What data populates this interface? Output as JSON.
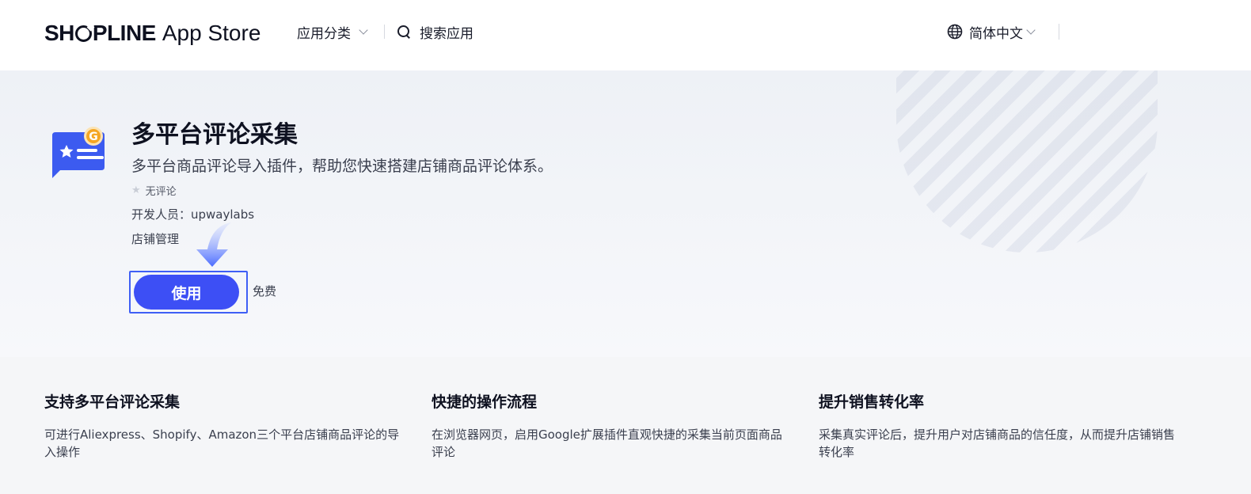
{
  "header": {
    "brand_logo": "SHOPLINE",
    "brand_store": "App Store",
    "nav_categories": "应用分类",
    "nav_search": "搜索应用",
    "language": "简体中文"
  },
  "app": {
    "title": "多平台评论采集",
    "subtitle": "多平台商品评论导入插件，帮助您快速搭建店铺商品评论体系。",
    "rating_text": "无评论",
    "developer": "开发人员：upwaylabs",
    "category": "店铺管理",
    "use_label": "使用",
    "price": "免费",
    "icon_badge_letter": "G"
  },
  "features": [
    {
      "title": "支持多平台评论采集",
      "desc": "可进行Aliexpress、Shopify、Amazon三个平台店铺商品评论的导入操作"
    },
    {
      "title": "快捷的操作流程",
      "desc": "在浏览器网页，启用Google扩展插件直观快捷的采集当前页面商品评论"
    },
    {
      "title": "提升销售转化率",
      "desc": "采集真实评论后，提升用户对店铺商品的信任度，从而提升店铺销售转化率"
    }
  ],
  "colors": {
    "primary": "#3d4ff5",
    "highlight_frame": "#3f5ff5",
    "badge": "#f5a623"
  },
  "icons": {
    "search": "search-icon",
    "globe": "globe-icon",
    "chevron": "chevron-down-icon",
    "star": "star-icon",
    "arrow": "arrow-down-icon"
  }
}
